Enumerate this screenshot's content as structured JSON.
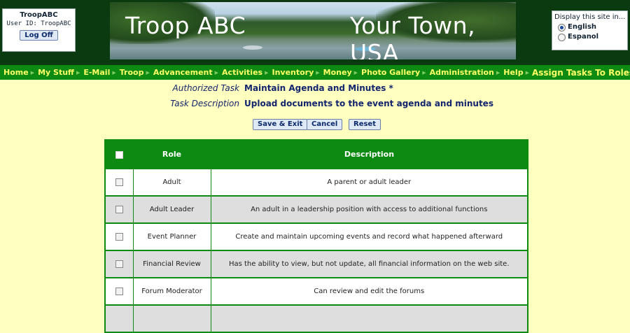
{
  "user": {
    "account": "TroopABC",
    "user_id": "User ID:  TroopABC",
    "logoff": "Log Off"
  },
  "banner": {
    "left_title": "Troop ABC",
    "right_title": "Your Town, USA"
  },
  "language": {
    "header": "Display this site in...",
    "options": [
      "English",
      "Espanol"
    ],
    "selected": "English"
  },
  "nav": {
    "items": [
      "Home",
      "My Stuff",
      "E-Mail",
      "Troop",
      "Advancement",
      "Activities",
      "Inventory",
      "Money",
      "Photo Gallery",
      "Administration",
      "Help"
    ],
    "current": "Assign Tasks To Roles"
  },
  "task": {
    "authorized_label": "Authorized Task",
    "authorized_value": "Maintain Agenda and Minutes *",
    "description_label": "Task Description",
    "description_value": "Upload documents to the event agenda and minutes"
  },
  "buttons": {
    "save_exit": "Save & Exit",
    "cancel": "Cancel",
    "reset": "Reset"
  },
  "table": {
    "headers": [
      "Role",
      "Description"
    ],
    "rows": [
      {
        "role": "Adult",
        "description": "A parent or adult leader"
      },
      {
        "role": "Adult Leader",
        "description": "An adult in a leadership position with access to additional functions"
      },
      {
        "role": "Event Planner",
        "description": "Create and maintain upcoming events and record what happened afterward"
      },
      {
        "role": "Financial Review",
        "description": "Has the ability to view, but not update, all financial information on the web site."
      },
      {
        "role": "Forum Moderator",
        "description": "Can review and edit the forums"
      }
    ]
  },
  "colors": {
    "page_bg": "#ffffc0",
    "header_bg": "#0b3a10",
    "nav_bg": "#0d8a12",
    "nav_text": "#ffff66",
    "label_text": "#13256e"
  }
}
